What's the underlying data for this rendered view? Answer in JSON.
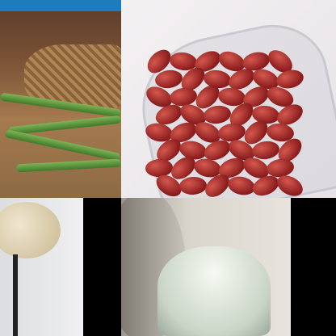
{
  "panels": [
    {
      "subject": "green-beans",
      "accent": "#1e7bbd"
    },
    {
      "subject": "kidney-beans",
      "accent": "#a3262a"
    },
    {
      "subject": "garlic",
      "accent": "#dcdde0"
    },
    {
      "subject": "water-glass",
      "accent": "#d9d4cc"
    }
  ]
}
